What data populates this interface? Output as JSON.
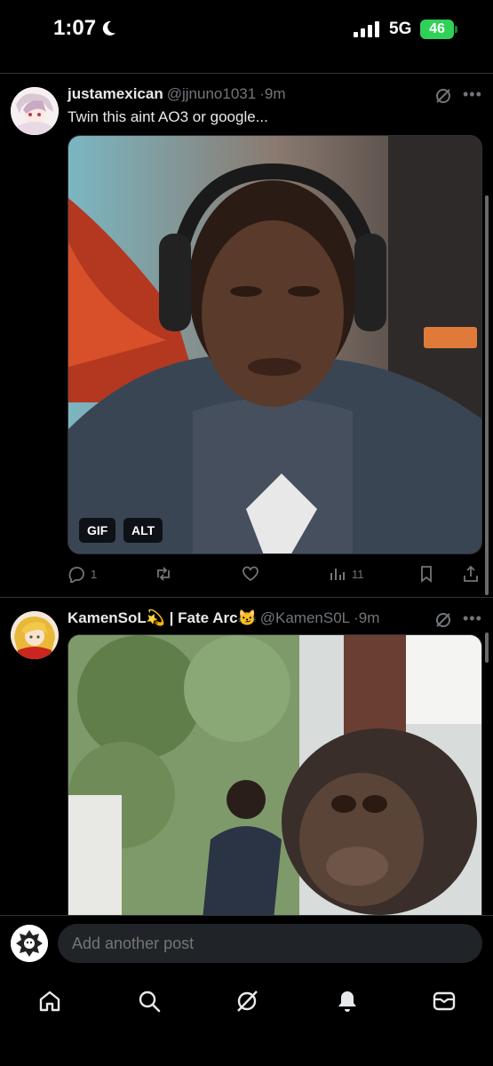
{
  "status_bar": {
    "time": "1:07",
    "network": "5G",
    "battery": "46"
  },
  "posts": [
    {
      "display_name": "justamexican",
      "handle": "@jjnuno1031",
      "age": "9m",
      "text": "Twin this aint AO3 or google...",
      "media_badges": [
        "GIF",
        "ALT"
      ],
      "replies": "1",
      "retweets": "",
      "likes": "",
      "views": "11"
    },
    {
      "display_name": "KamenSoL💫 | Fate Arc😼",
      "handle": "@KamenS0L",
      "age": "9m"
    }
  ],
  "reply_bar": {
    "placeholder": "Add another post"
  },
  "tabs": [
    "home-icon",
    "search-icon",
    "grok-icon",
    "notifications-icon",
    "messages-icon"
  ],
  "colors": {
    "background": "#000000",
    "text": "#e7e9ea",
    "muted": "#71767b",
    "divider": "#2f3336",
    "battery": "#30d158"
  }
}
